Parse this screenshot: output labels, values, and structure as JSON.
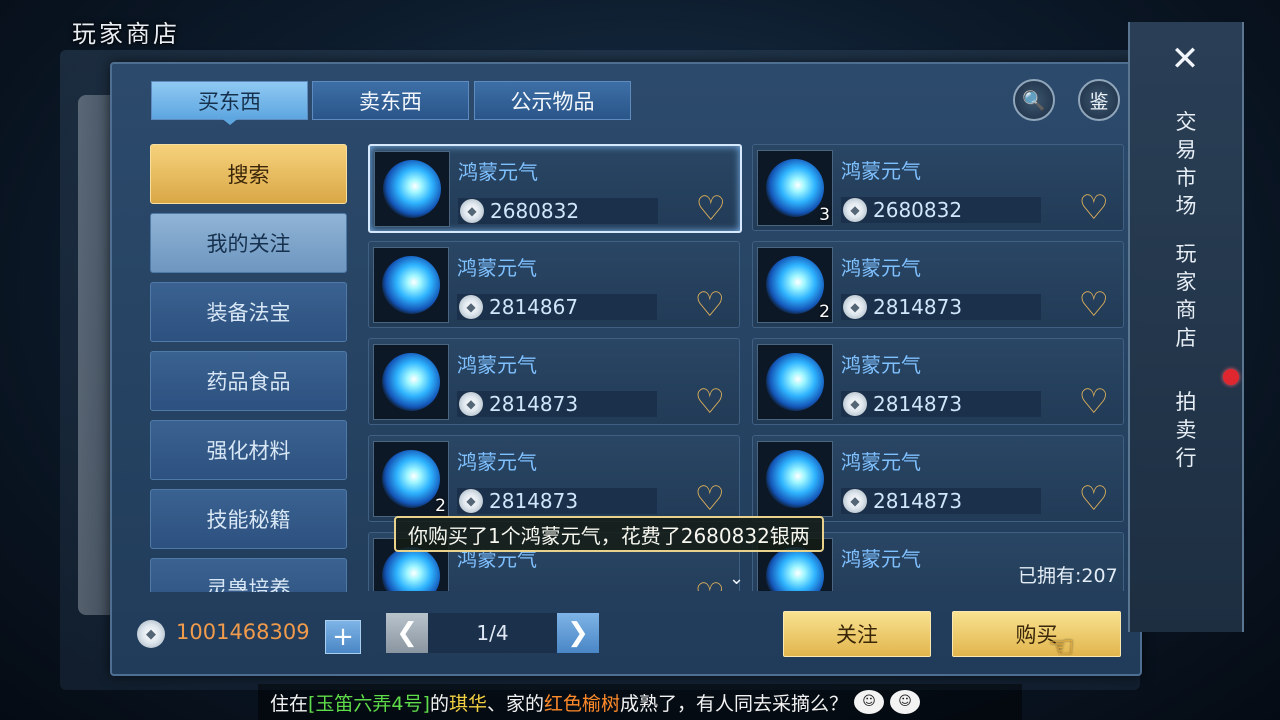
{
  "page_title": "玩家商店",
  "tabs": [
    {
      "label": "买东西",
      "active": true
    },
    {
      "label": "卖东西",
      "active": false
    },
    {
      "label": "公示物品",
      "active": false
    }
  ],
  "toolbar": {
    "appraise_label": "鉴"
  },
  "categories": [
    {
      "label": "搜索"
    },
    {
      "label": "我的关注"
    },
    {
      "label": "装备法宝"
    },
    {
      "label": "药品食品"
    },
    {
      "label": "强化材料"
    },
    {
      "label": "技能秘籍"
    },
    {
      "label": "灵兽培养"
    }
  ],
  "items": [
    {
      "name": "鸿蒙元气",
      "price": "2680832",
      "qty": ""
    },
    {
      "name": "鸿蒙元气",
      "price": "2680832",
      "qty": "3"
    },
    {
      "name": "鸿蒙元气",
      "price": "2814867",
      "qty": ""
    },
    {
      "name": "鸿蒙元气",
      "price": "2814873",
      "qty": "2"
    },
    {
      "name": "鸿蒙元气",
      "price": "2814873",
      "qty": ""
    },
    {
      "name": "鸿蒙元气",
      "price": "2814873",
      "qty": ""
    },
    {
      "name": "鸿蒙元气",
      "price": "2814873",
      "qty": "2"
    },
    {
      "name": "鸿蒙元气",
      "price": "2814873",
      "qty": ""
    },
    {
      "name": "鸿蒙元气",
      "price": "",
      "qty": ""
    },
    {
      "name": "鸿蒙元气",
      "price": "",
      "qty": ""
    }
  ],
  "toast": "你购买了1个鸿蒙元气，花费了2680832银两",
  "owned_label": "已拥有:207",
  "money": "1001468309",
  "pager": {
    "page": "1/4"
  },
  "buttons": {
    "follow": "关注",
    "buy": "购买"
  },
  "side_nav": [
    {
      "label": "交易市场"
    },
    {
      "label": "玩家商店"
    },
    {
      "label": "拍卖行"
    }
  ],
  "chat": {
    "prefix": "住在",
    "location": "[玉笛六弄4号]",
    "mid1": "的",
    "name": "琪华",
    "mid2": "、家的",
    "tree": "红色榆树",
    "suffix": "成熟了，有人同去采摘么？"
  }
}
